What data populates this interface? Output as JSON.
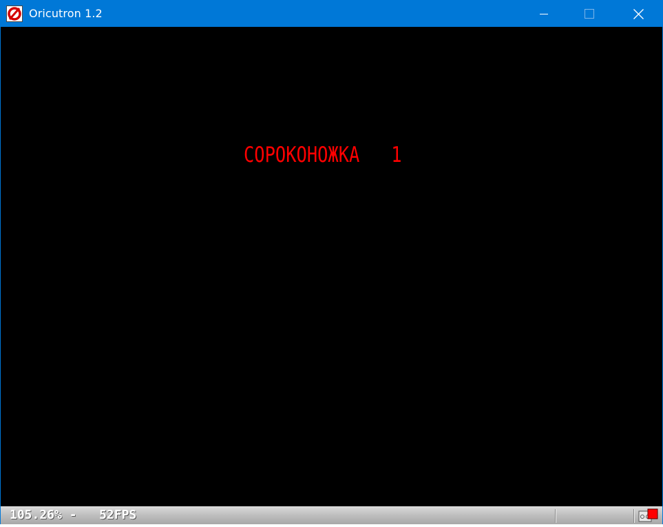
{
  "window": {
    "title": "Oricutron 1.2",
    "icon": "oricutron-logo-icon",
    "controls": {
      "minimize_icon": "minimize-icon",
      "maximize_icon": "maximize-icon",
      "close_icon": "close-icon"
    }
  },
  "screen": {
    "text": "СОРОКОНОЖКА   1",
    "text_color": "#ff0000",
    "background": "#000000"
  },
  "statusbar": {
    "speed": "105.26% -",
    "fps": "52FPS",
    "tape_icon": "tape-activity-icon"
  },
  "colors": {
    "titlebar": "#0078d7"
  }
}
